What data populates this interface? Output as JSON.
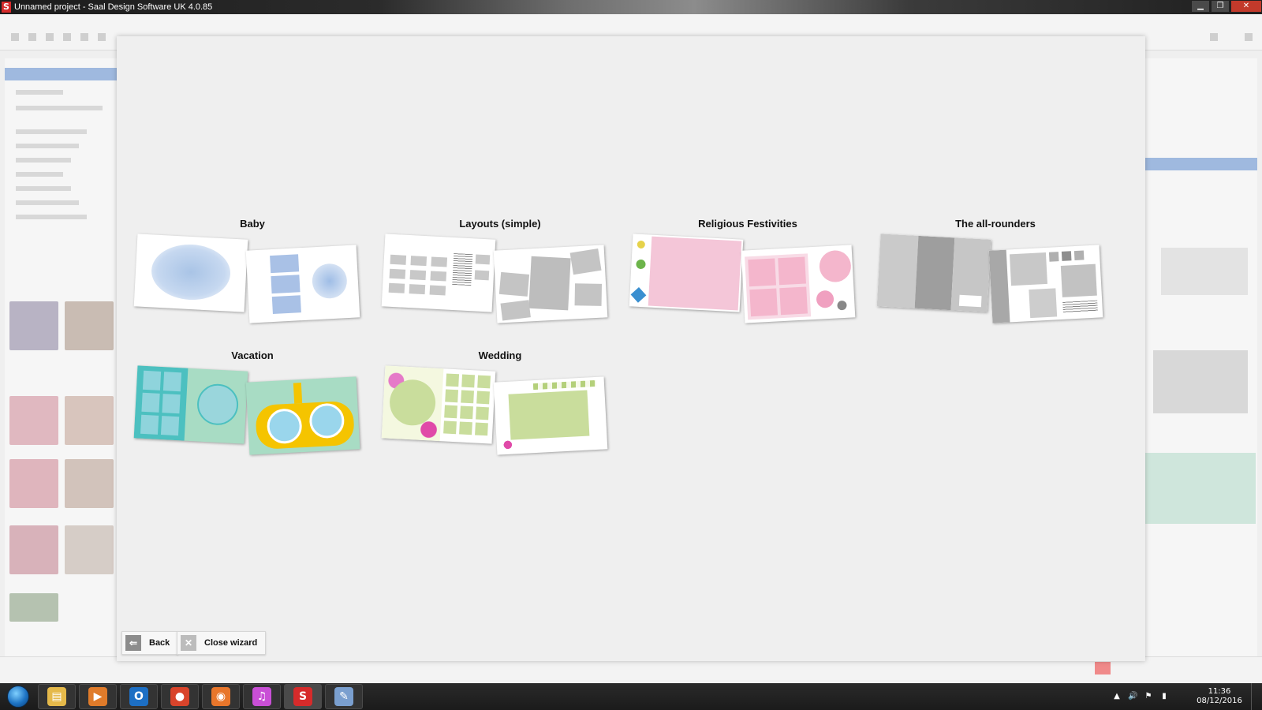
{
  "window": {
    "title": "Unnamed project - Saal Design Software UK 4.0.85",
    "app_icon_letter": "S"
  },
  "window_controls": {
    "minimize": "▁",
    "maximize": "❐",
    "close": "✕"
  },
  "wizard": {
    "categories": [
      {
        "label": "Baby"
      },
      {
        "label": "Layouts (simple)"
      },
      {
        "label": "Religious Festivities"
      },
      {
        "label": "The all-rounders"
      },
      {
        "label": "Vacation"
      },
      {
        "label": "Wedding"
      }
    ],
    "back_label": "Back",
    "back_icon": "⇐",
    "close_label": "Close wizard",
    "close_icon": "✕"
  },
  "taskbar": {
    "apps": [
      {
        "name": "file-explorer",
        "glyph": "▤",
        "color": "#e5b94a"
      },
      {
        "name": "media-player",
        "glyph": "▶",
        "color": "#e07b2a"
      },
      {
        "name": "outlook",
        "glyph": "O",
        "color": "#1d6fc4"
      },
      {
        "name": "chrome",
        "glyph": "●",
        "color": "#d9442b"
      },
      {
        "name": "firefox",
        "glyph": "◉",
        "color": "#e8762b"
      },
      {
        "name": "itunes",
        "glyph": "♫",
        "color": "#c94fd6"
      },
      {
        "name": "saal",
        "glyph": "S",
        "color": "#d62b2b"
      },
      {
        "name": "paint",
        "glyph": "✎",
        "color": "#7a9fcf"
      }
    ],
    "time": "11:36",
    "date": "08/12/2016",
    "tray_icons": [
      "▲",
      "🔊",
      "⚑",
      "▮"
    ]
  }
}
